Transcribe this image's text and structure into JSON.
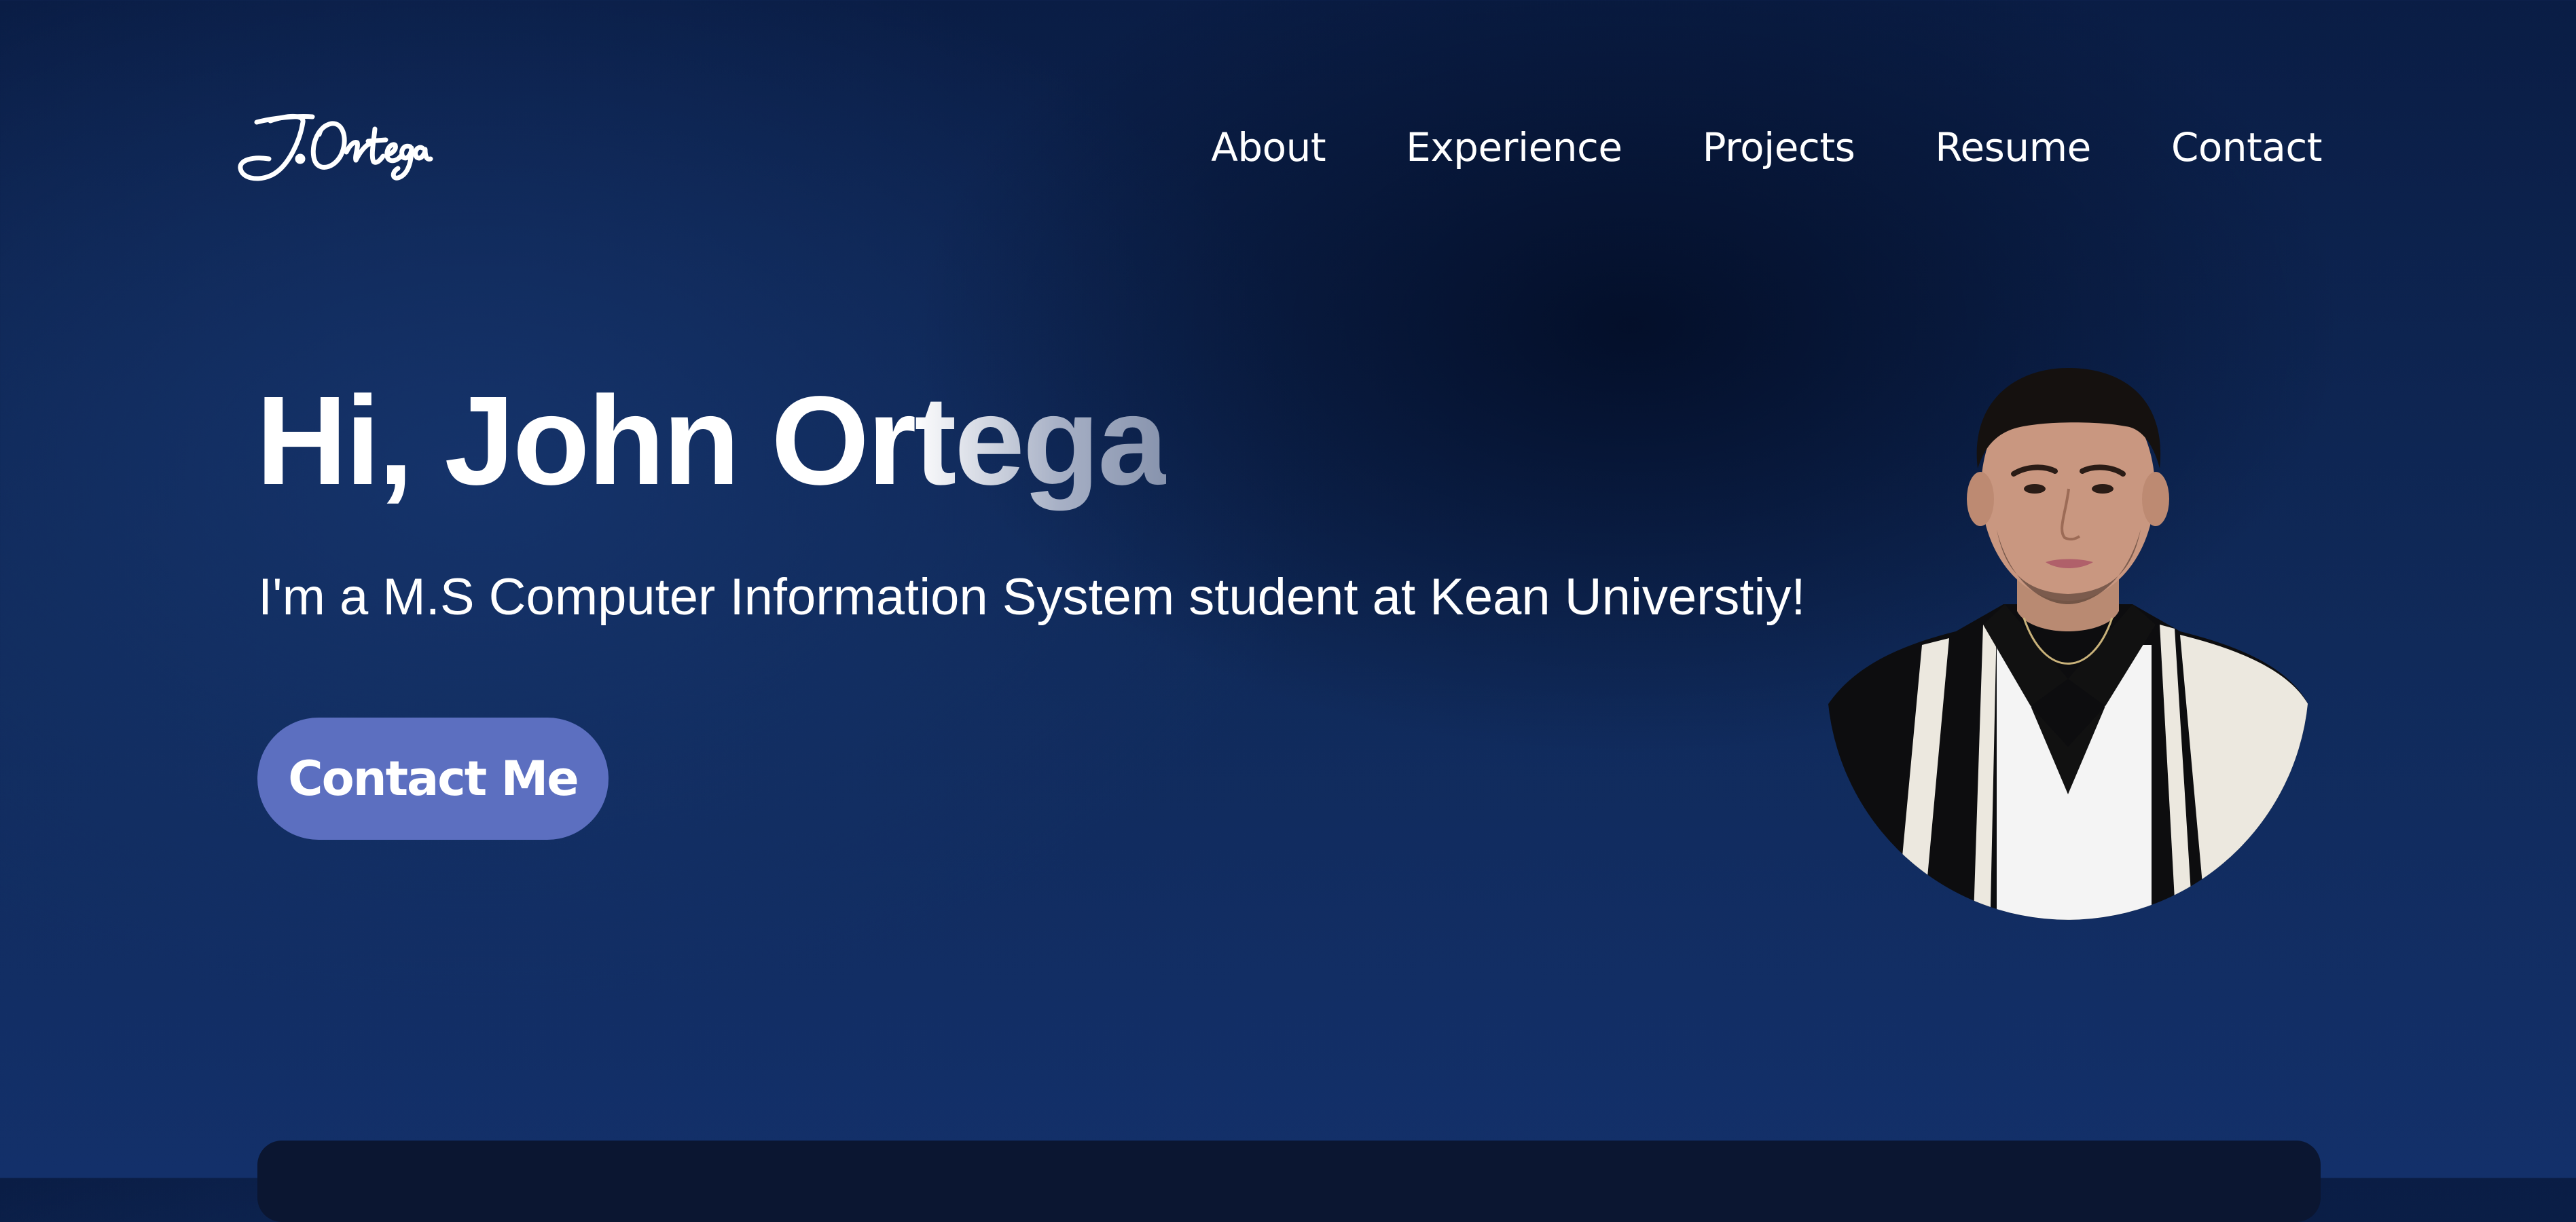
{
  "logo": {
    "text": "J.Ortega",
    "icon": "signature-logo"
  },
  "nav": {
    "items": [
      {
        "label": "About"
      },
      {
        "label": "Experience"
      },
      {
        "label": "Projects"
      },
      {
        "label": "Resume"
      },
      {
        "label": "Contact"
      }
    ]
  },
  "hero": {
    "title": "Hi, John Ortega",
    "subtitle": "I'm a M.S Computer Information System student at Kean Universtiy!",
    "cta_label": "Contact Me"
  },
  "colors": {
    "background_dark": "#061530",
    "background_mid": "#13306a",
    "accent_button": "#5c6fc0",
    "text": "#ffffff",
    "card": "#0b1631"
  }
}
